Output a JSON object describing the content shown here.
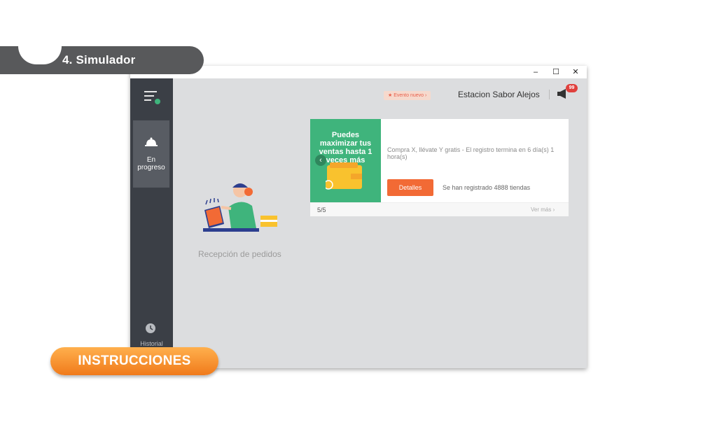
{
  "section_tab": {
    "label": "4. Simulador"
  },
  "window": {
    "controls": {
      "minimize": "–",
      "maximize": "☐",
      "close": "✕"
    }
  },
  "sidebar": {
    "menu_icon": "menu-icon",
    "active_item": {
      "icon": "service-bell-icon",
      "label_line1": "En",
      "label_line2": "progreso"
    },
    "history": {
      "icon": "clock-icon",
      "label": "Historial"
    }
  },
  "topbar": {
    "event_pill": "★ Evento nuevo  ›",
    "store_name": "Estacion Sabor Alejos",
    "notification_icon": "megaphone-icon",
    "notification_count": "99"
  },
  "main": {
    "empty_state_label": "Recepción de pedidos"
  },
  "promo_card": {
    "banner_text": "Puedes maximizar tus ventas hasta 1 veces más",
    "description": "Compra X, llévate Y gratis - El registro termina en 6 día(s) 1 hora(s)",
    "details_button": "Detalles",
    "registered_text": "Se han registrado 4888 tiendas",
    "pager": "5/5",
    "see_more": "Ver más  ›"
  },
  "instructions_button": "INSTRUCCIONES",
  "colors": {
    "sidebar": "#3b3f46",
    "accent_orange": "#f26a35",
    "banner_green": "#3fb47c",
    "badge_red": "#e0403d"
  }
}
